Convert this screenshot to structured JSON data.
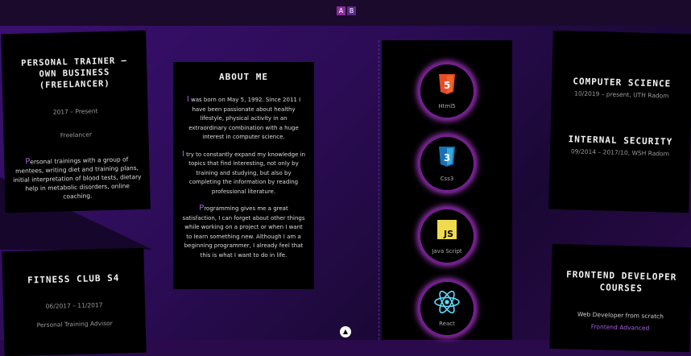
{
  "lang": {
    "a": "A",
    "b": "B"
  },
  "left_cards": [
    {
      "title": "PERSONAL TRAINER – OWN BUSINESS (FREELANCER)",
      "period": "2017 – Present",
      "role": "Freelancer",
      "description": "Personal trainings with a group of mentees, writing diet and training plans, initial interpretation of blood tests, dietary help in metabolic disorders, online coaching."
    },
    {
      "title": "FITNESS CLUB S4",
      "period": "06/2017 – 11/2017",
      "role": "Personal Training Advisor"
    }
  ],
  "about": {
    "title": "ABOUT ME",
    "p1": "I was born on May 5, 1992. Since 2011 I have been passionate about healthy lifestyle, physical activity in an extraordinary combination with a huge interest in computer science.",
    "p2": "I try to constantly expand my knowledge in topics that find interesting, not only by training and studying, but also by completing the information by reading professional literature.",
    "p3": "Programming gives me a great satisfaction, I can forget about other things while working on a project or when I want to learn something new. Although I am a beginning programmer, I already feel that this is what I want to do in life."
  },
  "skills": [
    {
      "name": "Html5",
      "icon": "html5-icon",
      "color": "#e44d26"
    },
    {
      "name": "Css3",
      "icon": "css3-icon",
      "color": "#1572b6"
    },
    {
      "name": "Java Script",
      "icon": "javascript-icon",
      "color": "#f0db4f"
    },
    {
      "name": "React",
      "icon": "react-icon",
      "color": "#61dafb"
    }
  ],
  "education": [
    {
      "title": "COMPUTER SCIENCE",
      "detail": "10/2019 – present, UTH Radom"
    },
    {
      "title": "INTERNAL SECURITY",
      "detail": "09/2014 – 2017/10, WSH Radom"
    }
  ],
  "courses": {
    "title": "FRONTEND DEVELOPER COURSES",
    "detail": "Web Developer from scratch",
    "more": "Frontend Advanced"
  },
  "accent": "#a45fe0"
}
